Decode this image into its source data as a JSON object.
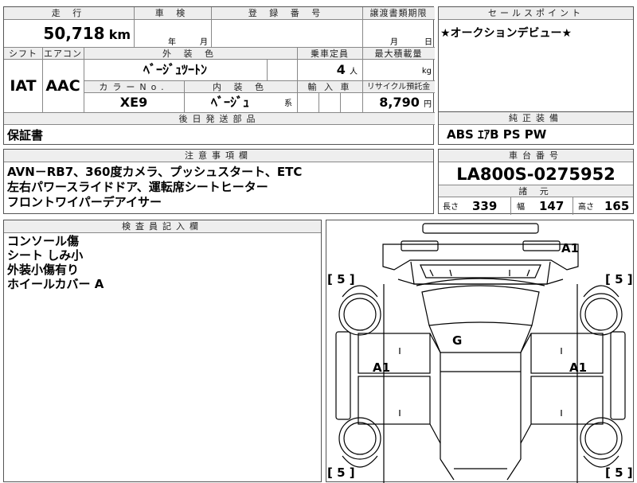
{
  "vehicle": {
    "mileage_header": "走 行",
    "mileage_value": "50,718",
    "mileage_unit": "km",
    "inspection_header": "車 検",
    "inspection_year_label": "年",
    "inspection_month_label": "月",
    "registration_header": "登 録 番 号",
    "transfer_deadline_header": "譲渡書類期限",
    "transfer_month_label": "月",
    "transfer_day_label": "日",
    "shift_header": "シフト",
    "shift_value": "IAT",
    "aircon_header": "エアコン",
    "aircon_value": "AAC",
    "exterior_color_header": "外 装 色",
    "exterior_color_value": "ﾍﾞｰｼﾞｭﾂｰﾄﾝ",
    "capacity_header": "乗車定員",
    "capacity_value": "4",
    "capacity_unit": "人",
    "max_load_header": "最大積載量",
    "max_load_unit": "kg",
    "color_no_header": "カラーNo.",
    "color_no_value": "XE9",
    "interior_color_header": "内 装 色",
    "interior_color_value": "ﾍﾞｰｼﾞｭ",
    "interior_color_suffix": "系",
    "import_header": "輸 入 車",
    "recycle_header": "リサイクル預託金",
    "recycle_value": "8,790",
    "recycle_unit": "円"
  },
  "sales_point": {
    "header": "セールスポイント",
    "text": "★オークションデビュー★"
  },
  "later_parts": {
    "header": "後日発送部品",
    "text": "保証書"
  },
  "genuine_equipment": {
    "header": "純正装備",
    "text": "ABS ｴｱB PS PW"
  },
  "notes": {
    "header": "注意事項欄",
    "lines": [
      "AVN－RB7、360度カメラ、プッシュスタート、ETC",
      "左右パワースライドドア、運転席シートヒーター",
      "フロントワイパーデアイサー"
    ]
  },
  "chassis": {
    "header": "車台番号",
    "value": "LA800S-0275952"
  },
  "dimensions": {
    "header": "諸 元",
    "length_label": "長さ",
    "length_value": "339",
    "width_label": "幅",
    "width_value": "147",
    "height_label": "高さ",
    "height_value": "165"
  },
  "inspector": {
    "header": "検査員記入欄",
    "lines": [
      "コンソール傷",
      "シート しみ小",
      "外装小傷有り",
      "ホイールカバー A"
    ]
  },
  "diagram": {
    "marks": {
      "roof_right": "A1",
      "front_left_tire": "[ 5 ]",
      "front_right_tire": "[ 5 ]",
      "windshield": "G",
      "left_door": "A1",
      "right_door": "A1",
      "rear_left_tire": "[ 5 ]",
      "rear_right_tire": "[ 5 ]"
    }
  }
}
